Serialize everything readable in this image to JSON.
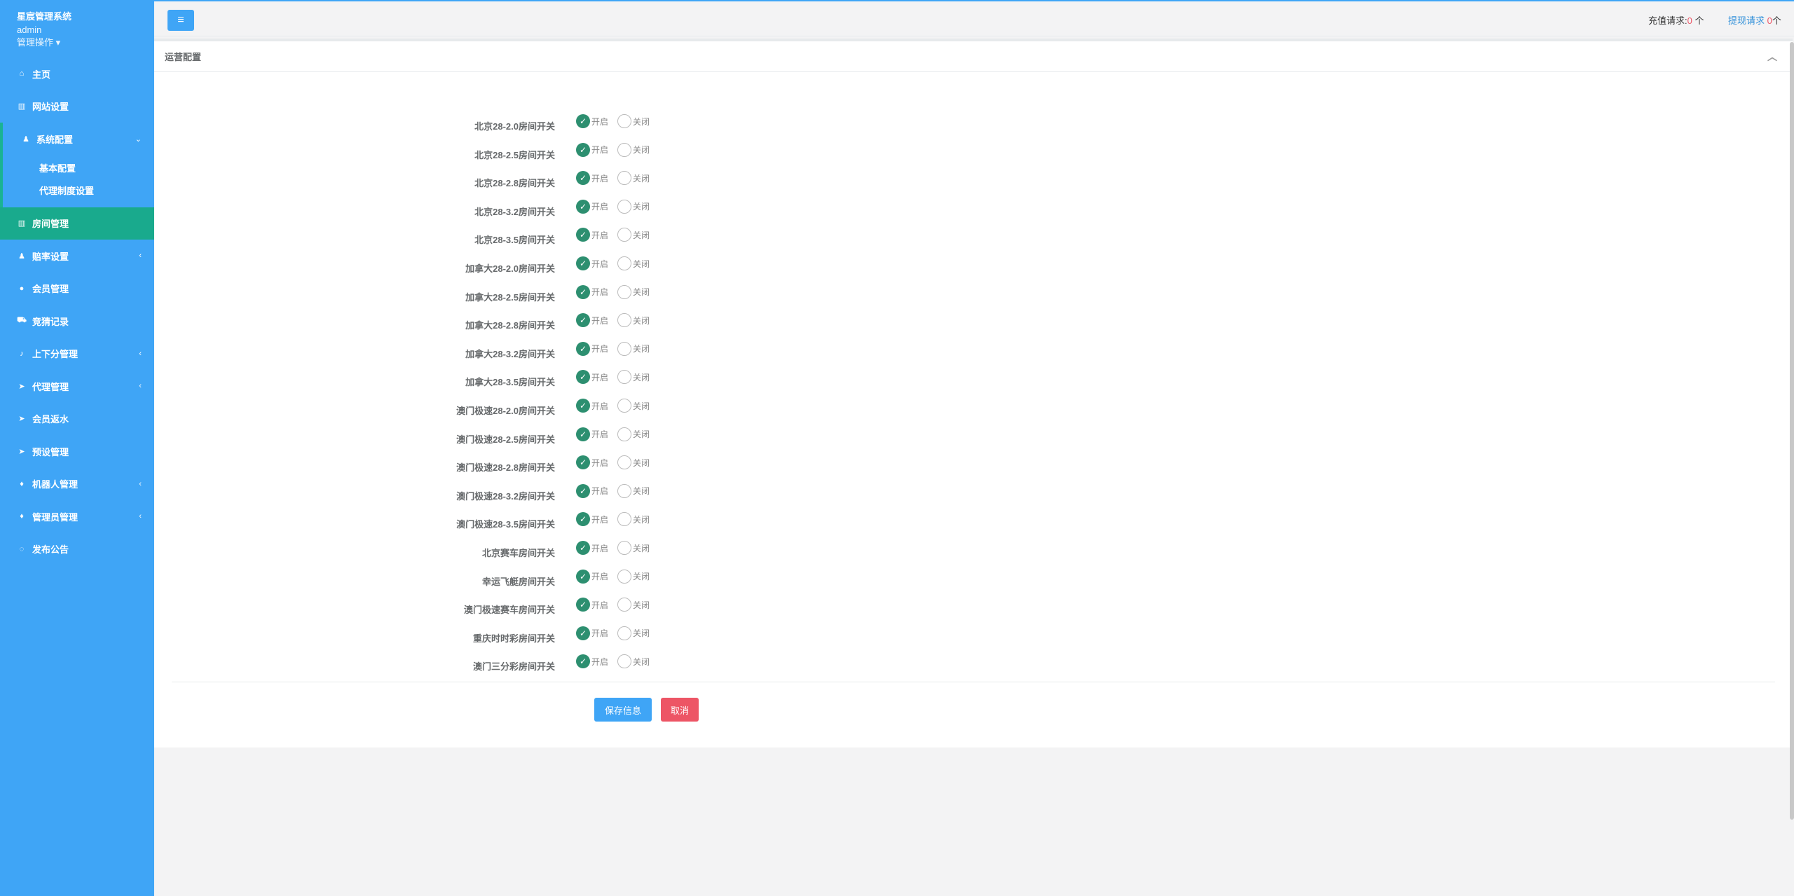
{
  "sidebar": {
    "system_name": "星宸管理系统",
    "username": "admin",
    "ops_label": "管理操作 ▾",
    "items": [
      {
        "label": "主页",
        "icon": "home-icon",
        "glyph": "⌂",
        "arrow": ""
      },
      {
        "label": "网站设置",
        "icon": "columns-icon",
        "glyph": "▥",
        "arrow": ""
      },
      {
        "label": "系统配置",
        "icon": "user-icon",
        "glyph": "♟",
        "arrow": "⌄"
      },
      {
        "label": "房间管理",
        "icon": "columns-icon",
        "glyph": "▥",
        "arrow": ""
      },
      {
        "label": "赔率设置",
        "icon": "user-icon",
        "glyph": "♟",
        "arrow": "‹"
      },
      {
        "label": "会员管理",
        "icon": "user-icon",
        "glyph": "●",
        "arrow": ""
      },
      {
        "label": "竞猜记录",
        "icon": "car-icon",
        "glyph": "⛟",
        "arrow": ""
      },
      {
        "label": "上下分管理",
        "icon": "music-icon",
        "glyph": "♪",
        "arrow": "‹"
      },
      {
        "label": "代理管理",
        "icon": "paper-plane-icon",
        "glyph": "➤",
        "arrow": "‹"
      },
      {
        "label": "会员返水",
        "icon": "paper-plane-icon",
        "glyph": "➤",
        "arrow": ""
      },
      {
        "label": "预设管理",
        "icon": "paper-plane-icon",
        "glyph": "➤",
        "arrow": ""
      },
      {
        "label": "机器人管理",
        "icon": "fire-icon",
        "glyph": "♦",
        "arrow": "‹"
      },
      {
        "label": "管理员管理",
        "icon": "fire-icon",
        "glyph": "♦",
        "arrow": "‹"
      },
      {
        "label": "发布公告",
        "icon": "comment-icon",
        "glyph": "◌",
        "arrow": ""
      }
    ],
    "submenu": [
      "基本配置",
      "代理制度设置"
    ]
  },
  "topbar": {
    "recharge_label": "充值请求:",
    "recharge_count": "0",
    "recharge_unit": " 个",
    "withdraw_label": "提现请求",
    "withdraw_count": "0",
    "withdraw_unit": "个"
  },
  "panel": {
    "title": "运营配置",
    "on_label": "开启",
    "off_label": "关闭",
    "rows": [
      "北京28-2.0房间开关",
      "北京28-2.5房间开关",
      "北京28-2.8房间开关",
      "北京28-3.2房间开关",
      "北京28-3.5房间开关",
      "加拿大28-2.0房间开关",
      "加拿大28-2.5房间开关",
      "加拿大28-2.8房间开关",
      "加拿大28-3.2房间开关",
      "加拿大28-3.5房间开关",
      "澳门极速28-2.0房间开关",
      "澳门极速28-2.5房间开关",
      "澳门极速28-2.8房间开关",
      "澳门极速28-3.2房间开关",
      "澳门极速28-3.5房间开关",
      "北京赛车房间开关",
      "幸运飞艇房间开关",
      "澳门极速赛车房间开关",
      "重庆时时彩房间开关",
      "澳门三分彩房间开关"
    ],
    "save_button": "保存信息",
    "cancel_button": "取消"
  }
}
